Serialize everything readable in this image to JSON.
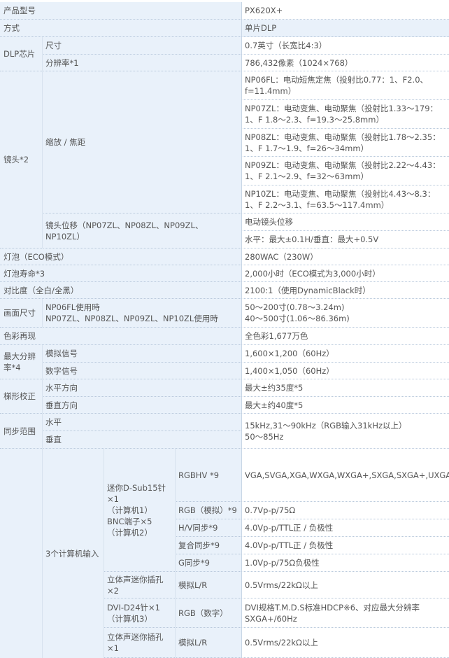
{
  "table": {
    "model_label": "产品型号",
    "model_value": "PX620X+",
    "method_label": "方式",
    "method_value": "单片DLP",
    "dlp": {
      "label": "DLP芯片",
      "size_label": "尺寸",
      "size_value": "0.7英寸（长宽比4:3）",
      "res_label": "分辨率*1",
      "res_value": "786,432像素（1024×768）"
    },
    "lens": {
      "label": "镜头*2",
      "zoom_label": "缩放 / 焦距",
      "zoom_values": [
        "NP06FL：电动短焦定焦（投射比0.77：1、F2.0、f=11.4mm）",
        "NP07ZL：电动变焦、电动聚焦（投射比1.33～179：1、F 1.8～2.3、f=19.3～25.8mm）",
        "NP08ZL：电动变焦、电动聚焦（投射比1.78～2.35：1、F 1.7～1.9、f=26～34mm）",
        "NP09ZL：电动变焦、电动聚焦（投射比2.22～4.43：1、F 2.1～2.9、f=32～63mm）",
        "NP10ZL：电动变焦、电动聚焦（投射比4.43～8.3：1、F 2.2～3.1、f=63.5～117.4mm）"
      ],
      "shift_label": "镜头位移（NP07ZL、NP08ZL、NP09ZL、NP10ZL）",
      "shift_value1": "电动镜头位移",
      "shift_value2": "水平：最大±0.1H/垂直：最大+0.5V"
    },
    "lamp_label": "灯泡（ECO模式）",
    "lamp_value": "280WAC（230W）",
    "life_label": "灯泡寿命*3",
    "life_value": "2,000小时（ECO模式为3,000小时）",
    "contrast_label": "对比度（全白/全黑）",
    "contrast_value": "2100:1（使用DynamicBlack时）",
    "screen": {
      "label": "画面尺寸",
      "sub_label": "NP06FL使用時\nNP07ZL、NP08ZL、NP09ZL、NP10ZL使用時",
      "value": "50～200寸(0.78～3.24m)\n40～500寸(1.06～86.36m)"
    },
    "color_label": "色彩再现",
    "color_value": "全色彩1,677万色",
    "maxres": {
      "label": "最大分辨率*4",
      "analog_label": "模拟信号",
      "analog_value": "1,600×1,200（60Hz）",
      "digital_label": "数字信号",
      "digital_value": "1,400×1,050（60Hz）"
    },
    "keystone": {
      "label": "梯形校正",
      "h_label": "水平方向",
      "h_value": "最大±约35度*5",
      "v_label": "垂直方向",
      "v_value": "最大±约40度*5"
    },
    "sync": {
      "label": "同步范围",
      "h_label": "水平",
      "v_label": "垂直",
      "value": "15kHz,31～90kHz（RGB输入31kHz以上）\n50～85Hz"
    },
    "inputs": {
      "label": "3个计算机输入",
      "dsub_label": "迷你D-Sub15针×1\n（计算机1）\nBNC端子×5\n（计算机2）",
      "rgbhv_label": "RGBHV *9",
      "rgbhv_value": "VGA,SVGA,XGA,WXGA,WXGA+,SXGA,SXGA+,UXGA",
      "rgb_analog_label": "RGB（模拟）*9",
      "rgb_analog_value": "0.7Vp-p/75Ω",
      "hv_label": "H/V同步*9",
      "hv_value": "4.0Vp-p/TTL正 / 负极性",
      "composite_label": "复合同步*9",
      "composite_value": "4.0Vp-p/TTL正 / 负极性",
      "g_label": "G同步*9",
      "g_value": "1.0Vp-p/75Ω负极性",
      "audio1_label": "立体声迷你插孔×2",
      "audio1_sub": "模拟L/R",
      "audio1_value": "0.5Vrms/22kΩ以上",
      "dvi_label": "DVI-D24针×1（计算机3）",
      "dvi_sub": "RGB（数字）",
      "dvi_value": "DVI规格T.M.D.S标准HDCP※6、对应最大分辨率SXGA+/60Hz",
      "audio2_label": "立体声迷你插孔×1",
      "audio2_sub": "模拟L/R",
      "audio2_value": "0.5Vrms/22kΩ以上"
    }
  }
}
